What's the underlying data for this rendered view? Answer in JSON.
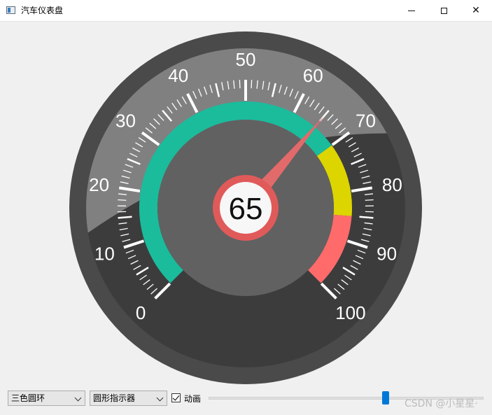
{
  "window": {
    "title": "汽车仪表盘"
  },
  "gauge": {
    "min": 0,
    "max": 100,
    "value": 65,
    "value_text": "65",
    "labels": [
      "0",
      "10",
      "20",
      "30",
      "40",
      "50",
      "60",
      "70",
      "80",
      "90",
      "100"
    ],
    "start_angle_deg": 225,
    "sweep_deg": 270,
    "ring_segments": [
      {
        "from": 0,
        "to": 70,
        "color": "#1abc9c"
      },
      {
        "from": 70,
        "to": 85,
        "color": "#dcd500"
      },
      {
        "from": 85,
        "to": 100,
        "color": "#ff6b6b"
      }
    ],
    "colors": {
      "outer_ring": "#4a4a4a",
      "face": "#3c3c3c",
      "inner_disc": "#616161",
      "pointer": "#e36a6a",
      "center_ring": "#e05a5a",
      "center_fill": "#f7f7f7",
      "scale": "#ffffff"
    }
  },
  "controls": {
    "ring_style_select": "三色圆环",
    "indicator_select": "圆形指示器",
    "animation_checkbox_label": "动画",
    "animation_checked": true,
    "slider_value": 65
  },
  "watermark": "CSDN @小星星·"
}
